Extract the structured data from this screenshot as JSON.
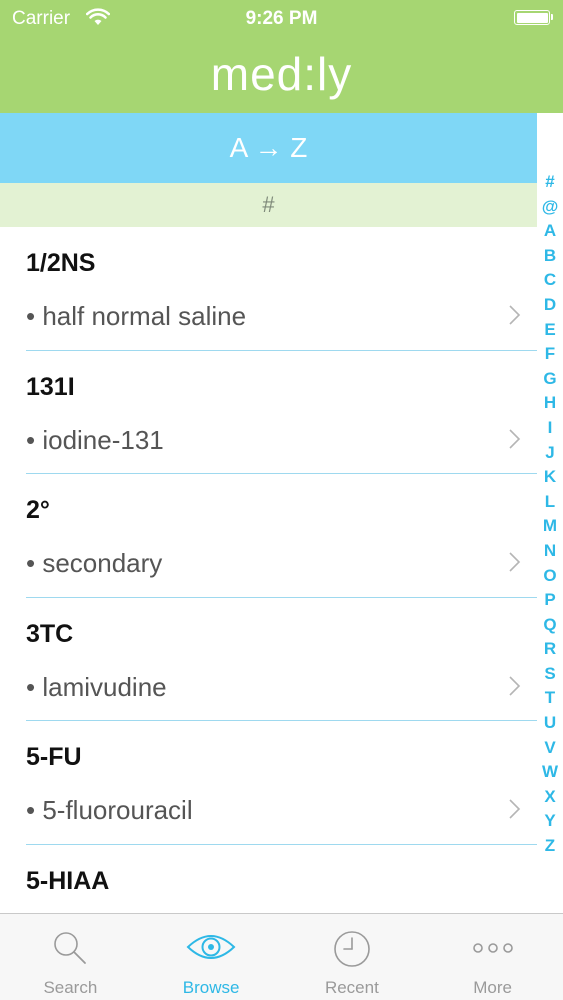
{
  "status_bar": {
    "carrier": "Carrier",
    "time": "9:26 PM"
  },
  "app": {
    "logo": "med:ly"
  },
  "browse": {
    "band_label": "A → Z",
    "section_label": "#"
  },
  "entries": [
    {
      "term": "1/2NS",
      "meaning": "• half normal saline"
    },
    {
      "term": "131I",
      "meaning": "• iodine-131"
    },
    {
      "term": "2°",
      "meaning": "• secondary"
    },
    {
      "term": "3TC",
      "meaning": "• lamivudine"
    },
    {
      "term": "5-FU",
      "meaning": "• 5-fluorouracil"
    },
    {
      "term": "5-HIAA",
      "meaning": ""
    }
  ],
  "index_letters": [
    "#",
    "@",
    "A",
    "B",
    "C",
    "D",
    "E",
    "F",
    "G",
    "H",
    "I",
    "J",
    "K",
    "L",
    "M",
    "N",
    "O",
    "P",
    "Q",
    "R",
    "S",
    "T",
    "U",
    "V",
    "W",
    "X",
    "Y",
    "Z"
  ],
  "tabs": [
    {
      "label": "Search",
      "icon": "search-icon",
      "active": false
    },
    {
      "label": "Browse",
      "icon": "eye-icon",
      "active": true
    },
    {
      "label": "Recent",
      "icon": "clock-icon",
      "active": false
    },
    {
      "label": "More",
      "icon": "more-dots-icon",
      "active": false
    }
  ],
  "colors": {
    "header_green": "#a6d672",
    "band_blue": "#7fd7f6",
    "section_bg": "#e3f2d3",
    "accent_blue": "#2eb8e6"
  }
}
